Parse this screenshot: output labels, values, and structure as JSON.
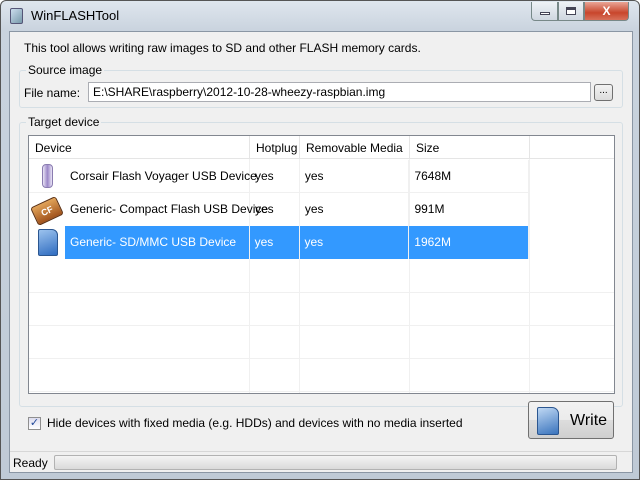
{
  "window": {
    "title": "WinFLASHTool",
    "close_glyph": "X"
  },
  "description": "This tool allows writing raw images to SD and other FLASH memory cards.",
  "source": {
    "group_label": "Source image",
    "file_label": "File name:",
    "file_value": "E:\\SHARE\\raspberry\\2012-10-28-wheezy-raspbian.img",
    "browse_label": "..."
  },
  "target": {
    "group_label": "Target device",
    "columns": [
      "Device",
      "Hotplug",
      "Removable Media",
      "Size"
    ],
    "rows": [
      {
        "device": "Corsair Flash Voyager USB Device",
        "hotplug": "yes",
        "removable": "yes",
        "size": "7648M",
        "icon": "usb-stick-icon"
      },
      {
        "device": "Generic- Compact Flash USB Device",
        "hotplug": "yes",
        "removable": "yes",
        "size": "991M",
        "icon": "compact-flash-icon",
        "icon_text": "CF"
      },
      {
        "device": "Generic- SD/MMC USB Device",
        "hotplug": "yes",
        "removable": "yes",
        "size": "1962M",
        "icon": "sd-card-icon",
        "selected": true
      }
    ]
  },
  "hide_checkbox": {
    "label": "Hide devices with fixed media (e.g. HDDs) and devices with no media inserted",
    "checked": true,
    "glyph": "✓"
  },
  "write_button": {
    "label": "Write"
  },
  "status": {
    "text": "Ready",
    "progress": 0
  },
  "colors": {
    "selection": "#3399ff"
  }
}
